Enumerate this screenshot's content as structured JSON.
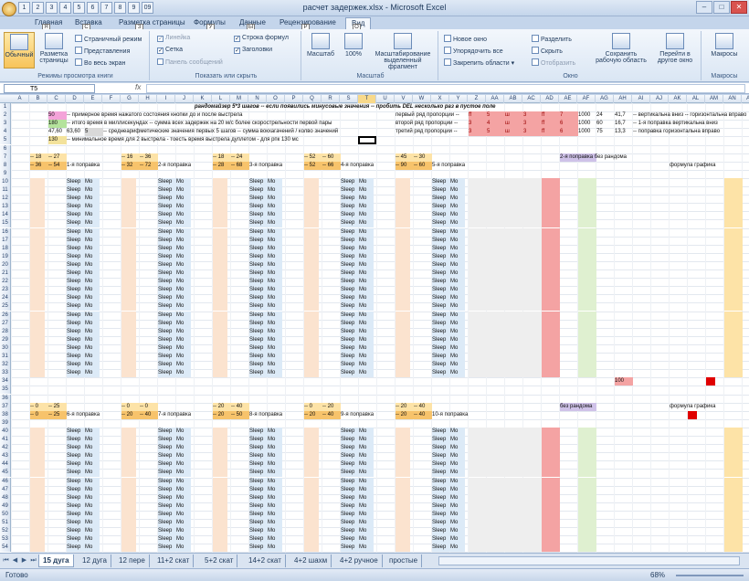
{
  "app": {
    "title": "расчет задержек.xlsx - Microsoft Excel",
    "qat_keys": [
      "1",
      "2",
      "3",
      "4",
      "5",
      "6",
      "7",
      "8",
      "9",
      "09"
    ]
  },
  "ribbon_tabs": [
    {
      "label": "Главная",
      "key": "Я"
    },
    {
      "label": "Вставка",
      "key": "С"
    },
    {
      "label": "Разметка страницы",
      "key": "З"
    },
    {
      "label": "Формулы",
      "key": "У"
    },
    {
      "label": "Данные",
      "key": "Ы"
    },
    {
      "label": "Рецензирование",
      "key": "Р"
    },
    {
      "label": "Вид",
      "key": "О"
    }
  ],
  "ribbon": {
    "modes": {
      "group_label": "Режимы просмотра книги",
      "normal": "Обычный",
      "page_layout": "Разметка страницы",
      "page_break": "Страничный режим",
      "custom_views": "Представления",
      "full_screen": "Во весь экран"
    },
    "show": {
      "group_label": "Показать или скрыть",
      "ruler": "Линейка",
      "grid": "Сетка",
      "messages": "Панель сообщений",
      "formula_bar": "Строка формул",
      "headings": "Заголовки"
    },
    "zoom": {
      "group_label": "Масштаб",
      "zoom": "Масштаб",
      "hundred": "100%",
      "to_selection": "Масштабирование выделенный фрагмент"
    },
    "window": {
      "group_label": "Окно",
      "new": "Новое окно",
      "arrange": "Упорядочить все",
      "freeze": "Закрепить области",
      "split": "Разделить",
      "hide": "Скрыть",
      "unhide": "Отобразить",
      "save_ws": "Сохранить рабочую область",
      "switch": "Перейти в другое окно"
    },
    "macros": {
      "group_label": "Макросы",
      "macros": "Макросы"
    }
  },
  "formula_bar": {
    "name_box": "T5",
    "fx": "fx",
    "content": ""
  },
  "columns": [
    "A",
    "B",
    "C",
    "D",
    "E",
    "F",
    "G",
    "H",
    "I",
    "J",
    "K",
    "L",
    "M",
    "N",
    "O",
    "P",
    "Q",
    "R",
    "S",
    "T",
    "U",
    "V",
    "W",
    "X",
    "Y",
    "Z",
    "AA",
    "AB",
    "AC",
    "AD",
    "AE",
    "AF",
    "AG",
    "AH",
    "AI",
    "AJ",
    "AK",
    "AL",
    "AM",
    "AN",
    "AO"
  ],
  "rows": [
    "1",
    "2",
    "3",
    "4",
    "5",
    "6",
    "7",
    "8",
    "9",
    "10",
    "11",
    "12",
    "13",
    "14",
    "15",
    "16",
    "17",
    "18",
    "19",
    "20",
    "21",
    "22",
    "23",
    "24",
    "25",
    "26",
    "27",
    "28",
    "29",
    "30",
    "31",
    "32",
    "33",
    "34",
    "35",
    "36",
    "37",
    "38",
    "39",
    "40",
    "41",
    "42",
    "43",
    "44",
    "45",
    "46",
    "47",
    "48",
    "49",
    "50",
    "51",
    "52",
    "53",
    "54"
  ],
  "sheet": {
    "title": "рандомайзер 5*3 шагов -- если появились минусовые значения -- пробить DEL несколько раз в пустое поле",
    "r2": {
      "v": "50",
      "t": "-- примерное время нажатого состояния кнопки до и после выстрела"
    },
    "r3": {
      "v": "180",
      "t": "-- итого время в миллисекундах -- сумма всех задержек на 20 м/с более скорострельности первой пары"
    },
    "r4": {
      "v1": "47,60",
      "v2": "63,60",
      "v3": "5",
      "t": "-- среднеарифметические значения первых 5 шагов -- сумма вокхагачений / колво значений"
    },
    "r5": {
      "v": "130",
      "t": "-- минимальное время для 2 выстрела - тоесть время выстрела дуплетом - для рпк 130 мс"
    },
    "tiers": [
      "первый ряд пропорции --",
      "второй ряд пропорции --",
      "третий ряд пропорции --"
    ],
    "tier_values": [
      [
        "ff",
        "5",
        "ш",
        "3",
        "ff",
        "7"
      ],
      [
        "3",
        "4",
        "ш",
        "3",
        "ff",
        "6"
      ],
      [
        "3",
        "5",
        "ш",
        "3",
        "ff",
        "6"
      ]
    ],
    "right_top": [
      [
        "1000",
        "24",
        "41,7"
      ],
      [
        "1000",
        "60",
        "16,7"
      ],
      [
        "1000",
        "75",
        "13,3"
      ]
    ],
    "right_notes": [
      "-- вертикальна вниз -- горизонтальна вправо",
      "-- 1-я поправка вертикальна вниз",
      "-- поправка горизонтальна вправо"
    ],
    "headers_a": [
      "-- 18",
      "-- 27",
      "-- 16",
      "-- 36",
      "-- 18",
      "-- 24",
      "-- 52",
      "-- 60",
      "-- 45",
      "-- 30"
    ],
    "headers_b": [
      "-- 36",
      "-- 54",
      "-- 32",
      "-- 72",
      "-- 28",
      "-- 68",
      "-- 52",
      "-- 66",
      "-- 90",
      "-- 60"
    ],
    "corrections": [
      "1-я поправка",
      "2-я поправка",
      "3-я поправка",
      "4-я поправка",
      "5-я поправка"
    ],
    "corrections2": [
      "6-я поправка",
      "7-я поправка",
      "8-я поправка",
      "9-я поправка",
      "10-я поправка"
    ],
    "headers2_a": [
      "-- 0",
      "-- 25",
      "-- 0",
      "-- 0",
      "-- 20",
      "-- 40",
      "-- 0",
      "-- 20",
      "-- 20",
      "-- 40"
    ],
    "headers2_b": [
      "-- 0",
      "-- 25",
      "-- 20",
      "-- 40",
      "-- 20",
      "-- 50",
      "-- 20",
      "-- 40",
      "-- 20",
      "-- 40"
    ],
    "rand_label": "2-я поправка без рандома",
    "rand_label2": "без рандома",
    "formula_label": "формула графика",
    "sleep_label": "Sleep",
    "mo_label": "Mo"
  },
  "sheet_tabs": [
    "15 дуга",
    "12 дуга",
    "12 пере",
    "11+2 скат",
    "5+2 скат",
    "14+2 скат",
    "4+2 шахм",
    "4+2 ручное",
    "простые"
  ],
  "status": {
    "ready": "Готово",
    "zoom": "68%"
  }
}
